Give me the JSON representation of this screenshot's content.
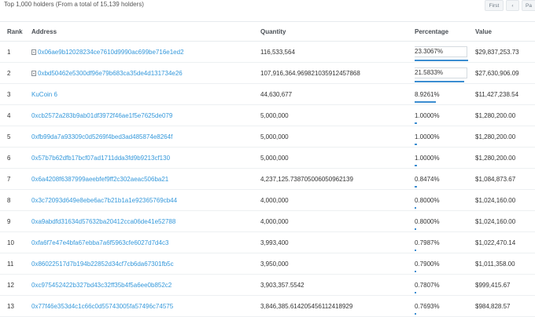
{
  "header": {
    "summary": "Top 1,000 holders (From a total of 15,139 holders)",
    "pager": {
      "first": "First",
      "prev": "‹",
      "next": "Pa"
    }
  },
  "table": {
    "columns": [
      "Rank",
      "Address",
      "Quantity",
      "Percentage",
      "Value"
    ],
    "rows": [
      {
        "rank": "1",
        "address": "0x06ae9b12028234ce7610d9990ac699be716e1ed2",
        "contract": true,
        "quantity": "116,533,564",
        "percentage": "23.3067%",
        "pct": 23.3067,
        "value": "$29,837,253.73",
        "highlight": true
      },
      {
        "rank": "2",
        "address": "0xbd50462e5300df96e79b683ca35de4d131734e26",
        "contract": true,
        "quantity": "107,916,364.969821035912457868",
        "percentage": "21.5833%",
        "pct": 21.5833,
        "value": "$27,630,906.09",
        "highlight": true
      },
      {
        "rank": "3",
        "address": "KuCoin 6",
        "contract": false,
        "quantity": "44,630,677",
        "percentage": "8.9261%",
        "pct": 8.9261,
        "value": "$11,427,238.54",
        "highlight": false
      },
      {
        "rank": "4",
        "address": "0xcb2572a283b9ab01df3972f46ae1f5e7625de079",
        "contract": false,
        "quantity": "5,000,000",
        "percentage": "1.0000%",
        "pct": 1.0,
        "value": "$1,280,200.00",
        "highlight": false
      },
      {
        "rank": "5",
        "address": "0xfb99da7a93309c0d5269f4bed3ad485874e8264f",
        "contract": false,
        "quantity": "5,000,000",
        "percentage": "1.0000%",
        "pct": 1.0,
        "value": "$1,280,200.00",
        "highlight": false
      },
      {
        "rank": "6",
        "address": "0x57b7b62dfb17bcf07ad1711dda3fd9b9213cf130",
        "contract": false,
        "quantity": "5,000,000",
        "percentage": "1.0000%",
        "pct": 1.0,
        "value": "$1,280,200.00",
        "highlight": false
      },
      {
        "rank": "7",
        "address": "0x6a4208f6387999aeebfef9ff2c302aeac506ba21",
        "contract": false,
        "quantity": "4,237,125.738705006050962139",
        "percentage": "0.8474%",
        "pct": 0.8474,
        "value": "$1,084,873.67",
        "highlight": false
      },
      {
        "rank": "8",
        "address": "0x3c72093d649e8ebe6ac7b21b1a1e92365769cb44",
        "contract": false,
        "quantity": "4,000,000",
        "percentage": "0.8000%",
        "pct": 0.8,
        "value": "$1,024,160.00",
        "highlight": false
      },
      {
        "rank": "9",
        "address": "0xa9abdfd31634d57632ba20412cca06de41e52788",
        "contract": false,
        "quantity": "4,000,000",
        "percentage": "0.8000%",
        "pct": 0.8,
        "value": "$1,024,160.00",
        "highlight": false
      },
      {
        "rank": "10",
        "address": "0xfa6f7e47e4bfa67ebba7a6f5963cfe6027d7d4c3",
        "contract": false,
        "quantity": "3,993,400",
        "percentage": "0.7987%",
        "pct": 0.7987,
        "value": "$1,022,470.14",
        "highlight": false
      },
      {
        "rank": "11",
        "address": "0x86022517d7b194b22852d34cf7cb6da67301fb5c",
        "contract": false,
        "quantity": "3,950,000",
        "percentage": "0.7900%",
        "pct": 0.79,
        "value": "$1,011,358.00",
        "highlight": false
      },
      {
        "rank": "12",
        "address": "0xc975452422b327bd43c32ff35b4f5a6ee0b852c2",
        "contract": false,
        "quantity": "3,903,357.5542",
        "percentage": "0.7807%",
        "pct": 0.7807,
        "value": "$999,415.67",
        "highlight": false
      },
      {
        "rank": "13",
        "address": "0x77f46e353d4c1c66c0d55743005fa57496c74575",
        "contract": false,
        "quantity": "3,846,385.614205456112418929",
        "percentage": "0.7693%",
        "pct": 0.7693,
        "value": "$984,828.57",
        "highlight": false
      }
    ]
  },
  "colors": {
    "link": "#3498db",
    "bar": "#3b8dd1"
  }
}
